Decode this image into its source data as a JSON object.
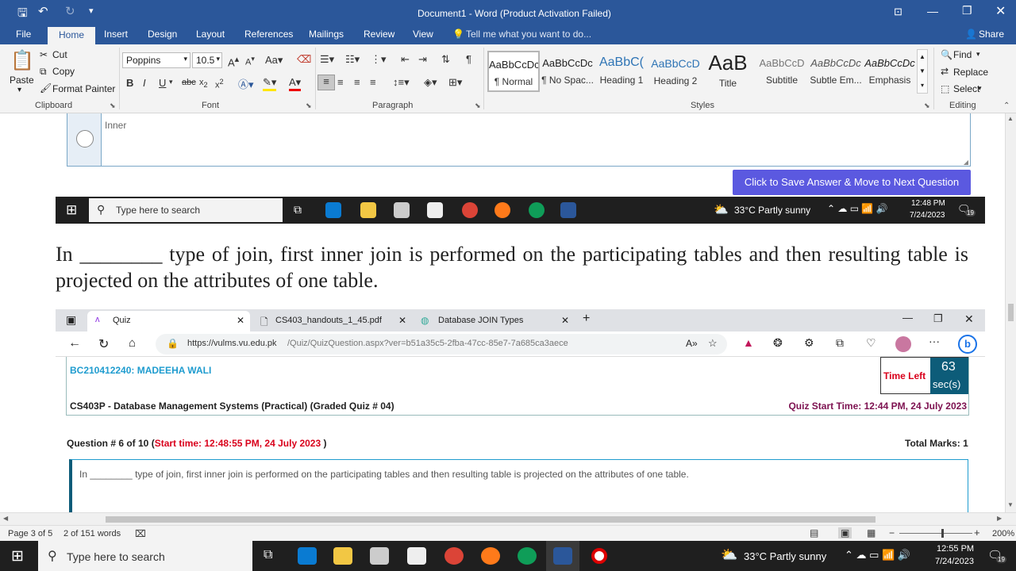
{
  "titlebar": {
    "title": "Document1 - Word (Product Activation Failed)"
  },
  "ribbon_tabs": [
    "File",
    "Home",
    "Insert",
    "Design",
    "Layout",
    "References",
    "Mailings",
    "Review",
    "View"
  ],
  "tell_me": "Tell me what you want to do...",
  "share": "Share",
  "clipboard": {
    "paste": "Paste",
    "cut": "Cut",
    "copy": "Copy",
    "format_painter": "Format Painter",
    "label": "Clipboard"
  },
  "font": {
    "name": "Poppins",
    "size": "10.5",
    "label": "Font"
  },
  "paragraph": {
    "label": "Paragraph"
  },
  "styles": {
    "label": "Styles",
    "items": [
      {
        "sample": "AaBbCcDc",
        "name": "¶ Normal"
      },
      {
        "sample": "AaBbCcDc",
        "name": "¶ No Spac..."
      },
      {
        "sample": "AaBbC(",
        "name": "Heading 1"
      },
      {
        "sample": "AaBbCcD",
        "name": "Heading 2"
      },
      {
        "sample": "AaB",
        "name": "Title"
      },
      {
        "sample": "AaBbCcD",
        "name": "Subtitle"
      },
      {
        "sample": "AaBbCcDc",
        "name": "Subtle Em..."
      },
      {
        "sample": "AaBbCcDc",
        "name": "Emphasis"
      }
    ]
  },
  "editing": {
    "find": "Find",
    "replace": "Replace",
    "select": "Select",
    "label": "Editing"
  },
  "doc": {
    "option_text": "Inner",
    "save_button": "Click to Save Answer & Move to Next Question",
    "question_text": "In ________ type of join, first inner join is performed on the participating tables and then resulting table is projected on the attributes of one table."
  },
  "inner_taskbar": {
    "search": "Type here to search",
    "weather": "33°C  Partly sunny",
    "time": "12:48 PM",
    "date": "7/24/2023",
    "badge": "19"
  },
  "browser": {
    "tabs": [
      "Quiz",
      "CS403_handouts_1_45.pdf",
      "Database JOIN Types"
    ],
    "url_host": "https://vulms.vu.edu.pk",
    "url_path": "/Quiz/QuizQuestion.aspx?ver=b51a35c5-2fba-47cc-85e7-7a685ca3aece"
  },
  "quiz": {
    "student": "BC210412240: MADEEHA WALI",
    "time_left_label": "Time Left",
    "time_left_value": "63",
    "time_left_unit": "sec(s)",
    "course": "CS403P - Database Management Systems (Practical) (Graded Quiz # 04)",
    "start_time": "Quiz Start Time: 12:44 PM, 24 July 2023",
    "question_no": "Question # 6 of 10",
    "paren_open": "(",
    "q_start": "Start time: 12:48:55 PM, 24 July 2023",
    "paren_close": ")",
    "total_marks": "Total Marks: 1",
    "question": "In ________ type of join, first inner join is performed on the participating tables and then resulting table is projected on the attributes of one table."
  },
  "status": {
    "page": "Page 3 of 5",
    "words": "2 of 151 words",
    "zoom": "200%"
  },
  "taskbar": {
    "search": "Type here to search",
    "weather": "33°C  Partly sunny",
    "time": "12:55 PM",
    "date": "7/24/2023",
    "badge": "19"
  }
}
